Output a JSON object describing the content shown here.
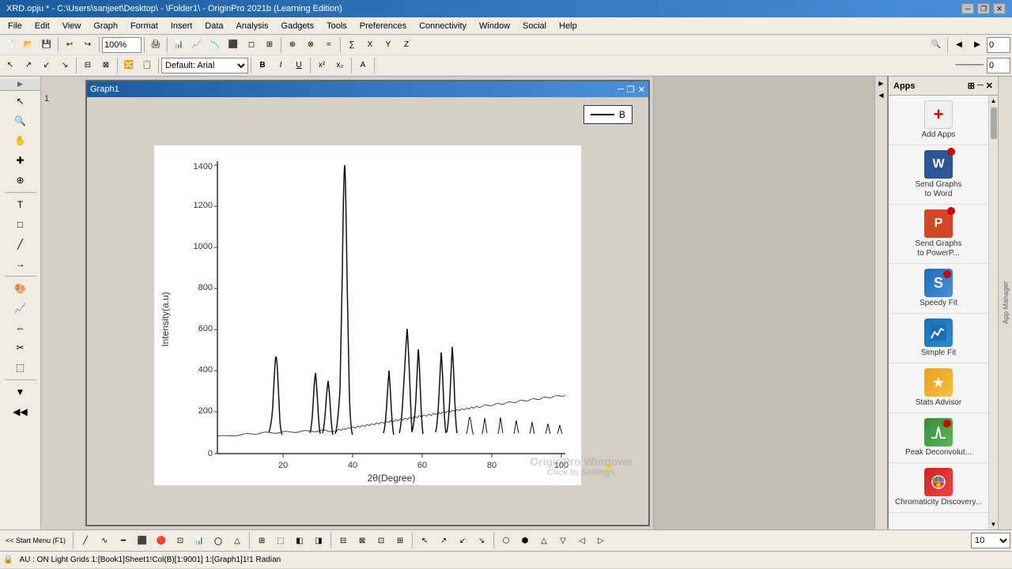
{
  "title": {
    "text": "XRD.opju * - C:\\Users\\sanjeet\\Desktop\\ - \\Folder1\\ - OriginPro 2021b (Learning Edition)",
    "buttons": [
      "minimize",
      "restore",
      "close"
    ]
  },
  "menu": {
    "items": [
      "File",
      "Edit",
      "View",
      "Graph",
      "Format",
      "Insert",
      "Data",
      "Analysis",
      "Gadgets",
      "Tools",
      "Preferences",
      "Connectivity",
      "Window",
      "Social",
      "Help"
    ]
  },
  "toolbar": {
    "zoom": "100%",
    "font": "Default: Arial",
    "fontSize": "10"
  },
  "apps_panel": {
    "title": "Apps",
    "items": [
      {
        "id": "add-apps",
        "label": "Add Apps",
        "icon": "add-icon"
      },
      {
        "id": "send-word",
        "label": "Send Graphs\nto Word",
        "icon": "word-icon"
      },
      {
        "id": "send-ppt",
        "label": "Send Graphs\nto PowerP...",
        "icon": "ppt-icon"
      },
      {
        "id": "speedy-fit",
        "label": "Speedy Fit",
        "icon": "speedyfit-icon"
      },
      {
        "id": "simple-fit",
        "label": "Simple Fit",
        "icon": "simplefit-icon"
      },
      {
        "id": "stats-advisor",
        "label": "Stats Advisor",
        "icon": "stats-icon"
      },
      {
        "id": "peak-deconv",
        "label": "Peak Deconvolut...",
        "icon": "peak-icon"
      },
      {
        "id": "chromaticity",
        "label": "Chromaticity\nDiscovery...",
        "icon": "chroma-icon"
      }
    ]
  },
  "graph": {
    "title": "Graph1",
    "legend": "B",
    "xLabel": "2θ(Degree)",
    "yLabel": "Intensity(a.u)",
    "xTicks": [
      "20",
      "40",
      "60",
      "80",
      "100"
    ],
    "yTicks": [
      "0",
      "200",
      "400",
      "600",
      "800",
      "1000",
      "1200",
      "1400"
    ],
    "page": "1"
  },
  "status_bar": {
    "text": "AU : ON  Light Grids  1:[Book1]Sheet1!Col(B)[1:9001]  1:[Graph1]1!1  Radian"
  },
  "bottom": {
    "start_menu": "<< Start Menu (F1)"
  }
}
